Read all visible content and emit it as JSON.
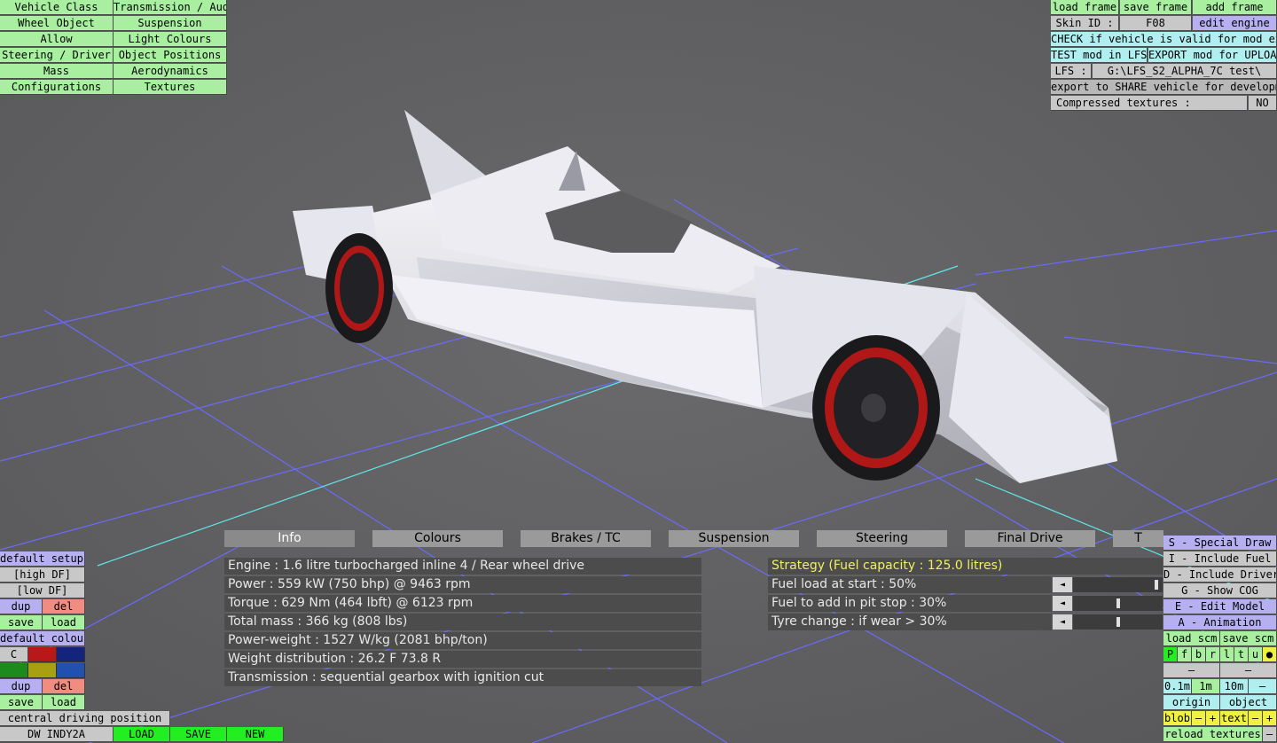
{
  "left_menu": [
    [
      "Vehicle Class",
      "Transmission / Audio"
    ],
    [
      "Wheel Object",
      "Suspension"
    ],
    [
      "Allow",
      "Light Colours"
    ],
    [
      "Steering / Driver",
      "Object Positions"
    ],
    [
      "Mass",
      "Aerodynamics"
    ],
    [
      "Configurations",
      "Textures"
    ]
  ],
  "top_right": {
    "load_frame": "load frame",
    "save_frame": "save frame",
    "add_frame": "add frame",
    "skin_label": "Skin ID :",
    "skin_value": "F08",
    "edit_engine": "edit engine",
    "check_valid": "CHECK if vehicle is valid for mod export",
    "test_mod": "TEST mod in LFS",
    "export_upload": "EXPORT mod for UPLOAD",
    "lfs_label": "LFS :",
    "lfs_path": "G:\\LFS_S2_ALPHA_7C test\\",
    "export_share": "export to SHARE vehicle for development",
    "compressed_label": "Compressed textures :",
    "compressed_value": "NO"
  },
  "tabs": [
    "Info",
    "Colours",
    "Brakes / TC",
    "Suspension",
    "Steering",
    "Final Drive",
    "T"
  ],
  "info_rows": [
    "Engine : 1.6 litre turbocharged inline 4 / Rear wheel drive",
    "Power : 559 kW (750 bhp) @ 9463 rpm",
    "Torque : 629 Nm (464 lbft) @ 6123 rpm",
    "Total mass : 366 kg (808 lbs)",
    "Power-weight : 1527 W/kg (2081 bhp/ton)",
    "Weight distribution : 26.2 F  73.8 R",
    "Transmission : sequential gearbox with ignition cut"
  ],
  "strategy": {
    "title": "Strategy (Fuel capacity : 125.0 litres)",
    "rows": [
      {
        "label": "Fuel load at start : 50%",
        "level": 0.95
      },
      {
        "label": "Fuel to add in pit stop : 30%",
        "level": 0.5
      },
      {
        "label": "Tyre change : if wear > 30%",
        "level": 0.5
      }
    ],
    "arrow": "◄"
  },
  "bottom_left": {
    "default_setups": "default setups",
    "high_df": "[high DF]",
    "low_df": "[low DF]",
    "dup": "dup",
    "del": "del",
    "save": "save",
    "load": "load",
    "default_colours": "default colours",
    "c": "C",
    "dup2": "dup",
    "del2": "del",
    "save2": "save",
    "load2": "load",
    "central": "central driving position",
    "car_name": "DW INDY2A",
    "load_btn": "LOAD",
    "save_btn": "SAVE",
    "new_btn": "NEW",
    "swatch_colors": [
      "#c8c8c8",
      "#b81818",
      "#14247a",
      "#1c8a1c",
      "#a8a010",
      "#2050b0"
    ]
  },
  "bottom_right": {
    "special_draw": "S - Special Draw",
    "include_fuel": "I - Include Fuel",
    "include_driver": "D - Include Driver",
    "show_cog": "G - Show COG",
    "edit_model": "E - Edit Model",
    "animation": "A - Animation",
    "load_scm": "load scm",
    "save_scm": "save scm",
    "letters": [
      "P",
      "f",
      "b",
      "r",
      "l",
      "t",
      "u",
      "●"
    ],
    "minus1": "–",
    "minus2": "–",
    "d01": "0.1m",
    "d1": "1m",
    "d10": "10m",
    "dminus": "–",
    "origin": "origin",
    "object": "object",
    "blob": "blob",
    "bminus": "–",
    "bplus": "+",
    "text": "text",
    "tminus": "–",
    "tplus": "+",
    "reload": "reload textures",
    "rminus": "–"
  }
}
